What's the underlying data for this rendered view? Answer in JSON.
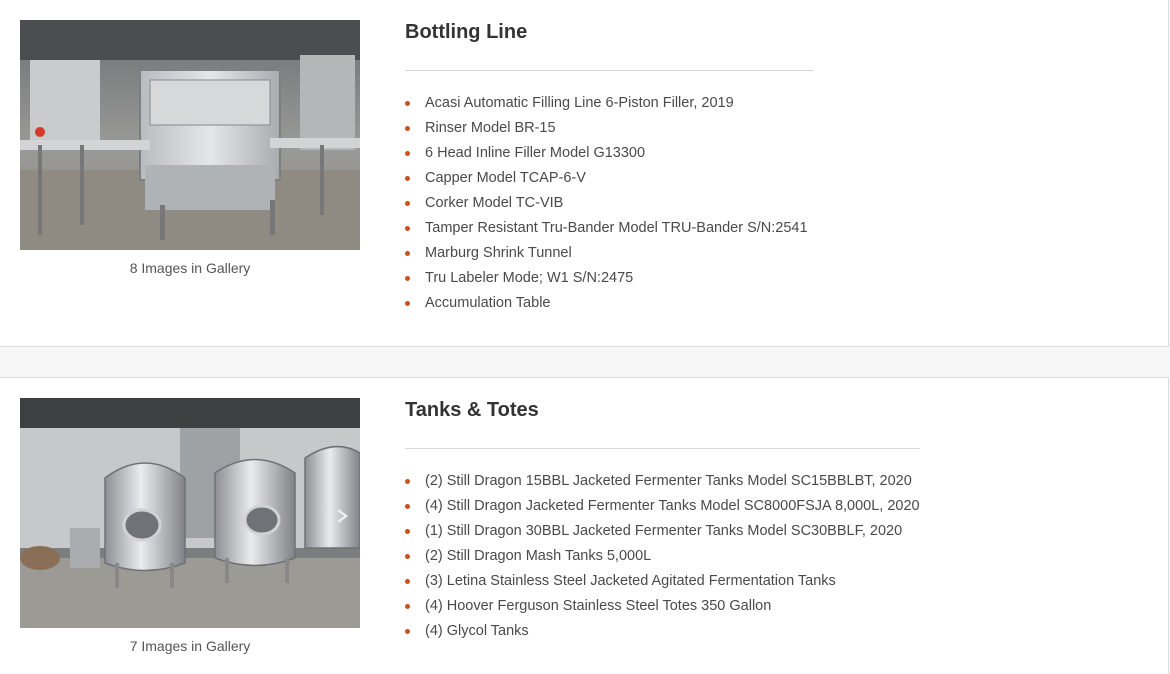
{
  "colors": {
    "bullet": "#c8531c",
    "divider": "#d8d8d8",
    "background": "#f7f7f7"
  },
  "sections": [
    {
      "title": "Bottling Line",
      "gallery_caption": "8 Images in Gallery",
      "items": [
        "Acasi Automatic Filling Line 6-Piston Filler, 2019",
        "Rinser Model BR-15",
        "6 Head Inline Filler Model G13300",
        "Capper Model TCAP-6-V",
        "Corker Model TC-VIB",
        "Tamper Resistant Tru-Bander Model TRU-Bander S/N:2541",
        "Marburg Shrink Tunnel",
        "Tru Labeler Mode; W1 S/N:2475",
        "Accumulation Table"
      ]
    },
    {
      "title": "Tanks & Totes",
      "gallery_caption": "7 Images in Gallery",
      "items": [
        "(2) Still Dragon 15BBL Jacketed Fermenter Tanks Model SC15BBLBT, 2020",
        "(4) Still Dragon Jacketed Fermenter Tanks Model SC8000FSJA 8,000L, 2020",
        "(1) Still Dragon 30BBL Jacketed Fermenter Tanks Model SC30BBLF, 2020",
        "(2) Still Dragon Mash Tanks 5,000L",
        "(3) Letina Stainless Steel Jacketed Agitated Fermentation Tanks",
        "(4) Hoover Ferguson Stainless Steel Totes 350 Gallon",
        "(4) Glycol Tanks"
      ]
    }
  ]
}
